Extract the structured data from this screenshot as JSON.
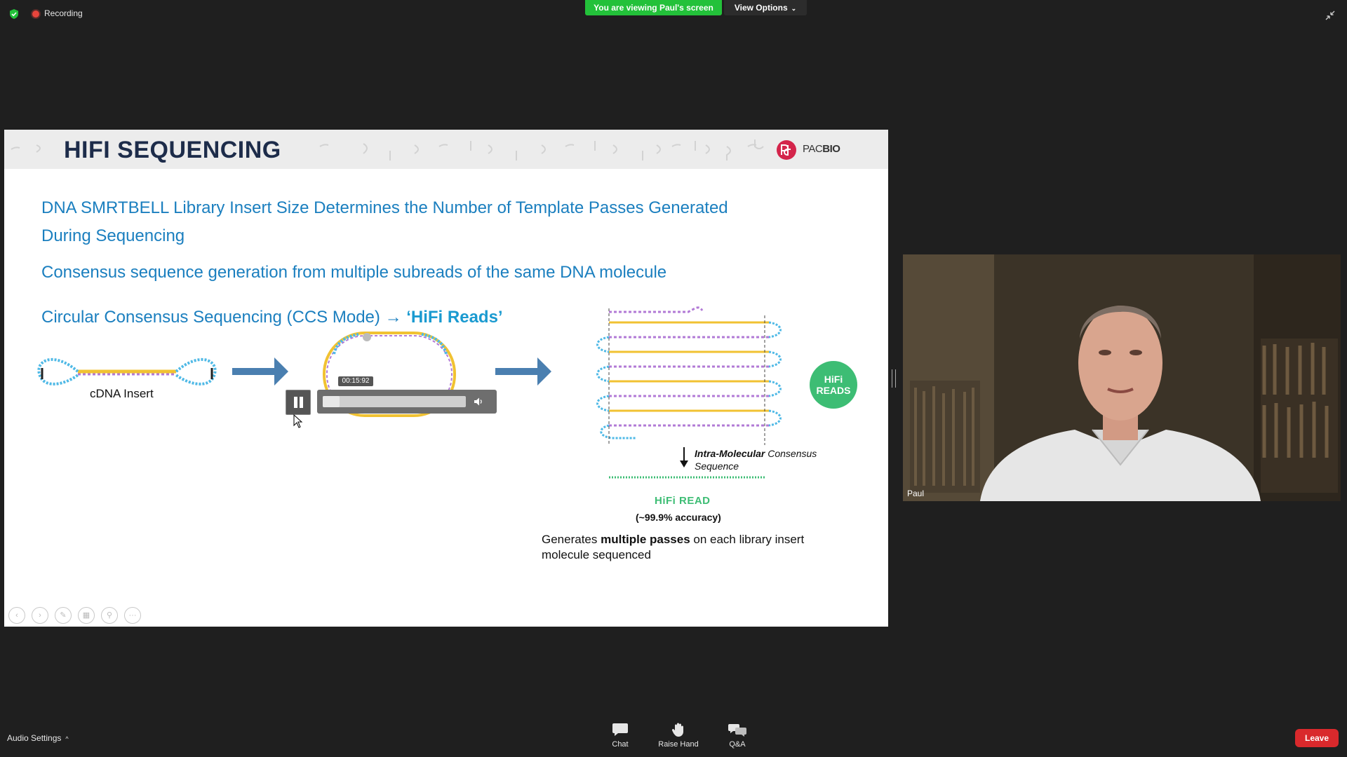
{
  "topbar": {
    "recording_label": "Recording",
    "viewing_banner": "You are viewing Paul's screen",
    "view_options_label": "View Options"
  },
  "slide": {
    "title": "HIFI SEQUENCING",
    "logo_text_a": "PAC",
    "logo_text_b": "BIO",
    "heading_1": "DNA SMRTBELL Library Insert Size Determines the Number of Template Passes Generated During Sequencing",
    "heading_2": "Consensus sequence generation from multiple subreads of the same DNA molecule",
    "heading_3_main": "Circular Consensus Sequencing (CCS Mode) ",
    "heading_3_arrow": "→",
    "heading_3_hifi": " ‘HiFi Reads’",
    "cdna_label": "cDNA Insert",
    "hifi_badge_line1": "HiFi",
    "hifi_badge_line2": "READS",
    "consensus_bold": "Intra-Molecular",
    "consensus_rest": " Consensus",
    "consensus_line2": "Sequence",
    "hifi_read_label": "HiFi READ",
    "accuracy_label": "(~99.9% accuracy)",
    "passes_pre": "Generates ",
    "passes_bold": "multiple passes",
    "passes_post": " on each library insert molecule sequenced",
    "colors": {
      "title": "#1d2c4a",
      "heading": "#1b7fbf",
      "hifi_green": "#3dbd74",
      "arrow_blue": "#4a7fb0"
    }
  },
  "player": {
    "time": "00:15:92",
    "progress": 0.08
  },
  "video": {
    "participant_name": "Paul"
  },
  "bottombar": {
    "audio_settings_label": "Audio Settings",
    "chat_label": "Chat",
    "raise_hand_label": "Raise Hand",
    "qa_label": "Q&A",
    "leave_label": "Leave"
  },
  "icons": [
    "shield-icon",
    "recording-icon",
    "chevron-down-icon",
    "exit-fullscreen-icon",
    "pause-icon",
    "volume-icon",
    "chat-icon",
    "raise-hand-icon",
    "qa-icon",
    "cursor-icon"
  ],
  "colors": {
    "background": "#1f1f1f",
    "banner_green": "#23c13a",
    "leave_red": "#d9292c"
  }
}
